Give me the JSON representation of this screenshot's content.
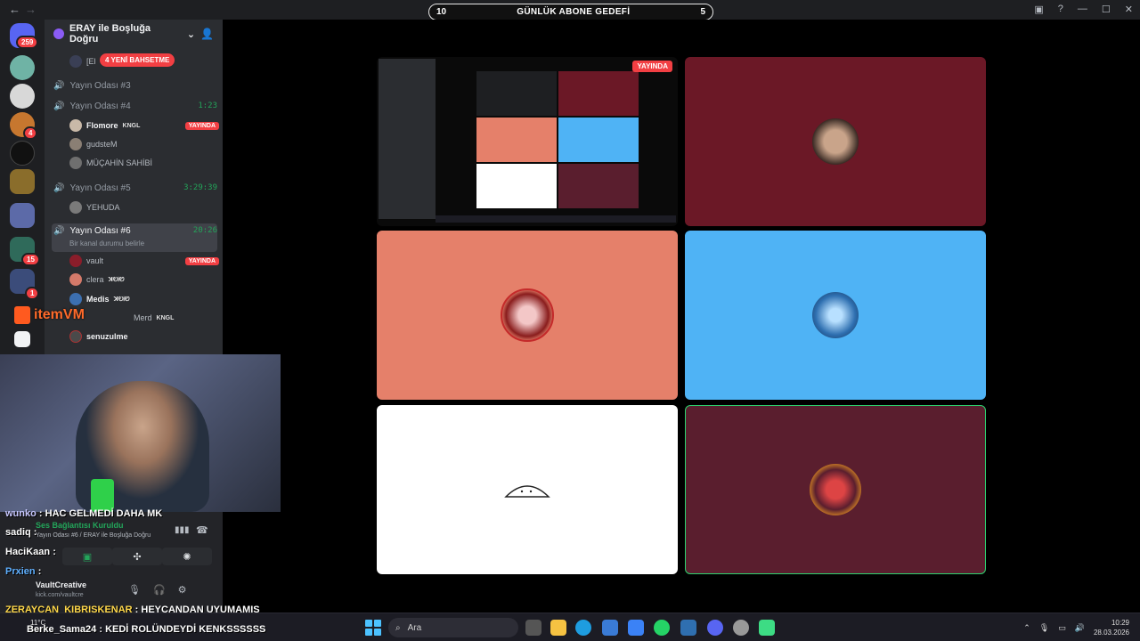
{
  "nav": {
    "back": "←",
    "forward": "→"
  },
  "goal": {
    "left": "10",
    "title": "GÜNLÜK ABONE GEDEFİ",
    "right": "5"
  },
  "window": {
    "inbox": "▣",
    "help": "?",
    "minimize": "—",
    "maximize": "☐",
    "close": "✕"
  },
  "rail": {
    "dm_badge": "259",
    "badge_2": "4",
    "badge_3": "15",
    "badge_4": "1"
  },
  "server": {
    "name": "ERAY ile Boşluğa Doğru",
    "chevron": "⌄",
    "mention_pill": "4 YENİ BAHSETME",
    "hidden_row": "[El"
  },
  "channels": [
    {
      "name": "Yayın Odası #3",
      "timer": ""
    },
    {
      "name": "Yayın Odası #4",
      "timer": "1:23"
    },
    {
      "name": "Yayın Odası #5",
      "timer": "3:29:39"
    },
    {
      "name": "Yayın Odası #6",
      "timer": "20:26",
      "status": "Bir kanal durumu belirle"
    }
  ],
  "room4_users": [
    {
      "name": "Flomore",
      "tag": "KNGL",
      "badge": "YAYINDA",
      "color": "#c9b9a8"
    },
    {
      "name": "gudsteM",
      "tag": "",
      "badge": "",
      "color": "#8a7f74"
    },
    {
      "name": "MÜÇAHİN SAHİBİ",
      "tag": "",
      "badge": "",
      "color": "#6f6f6f"
    }
  ],
  "room5_users": [
    {
      "name": "YEHUDA",
      "tag": "",
      "badge": "",
      "color": "#7a7a7a"
    }
  ],
  "room6_users": [
    {
      "name": "vault",
      "tag": "",
      "badge": "YAYINDA",
      "color": "#8a1d2a"
    },
    {
      "name": "clera",
      "tag": "ꓘᎧᎥᏬ",
      "badge": "",
      "color": "#d47a6a"
    },
    {
      "name": "Medis",
      "tag": "ꓘᎧᎥᏬ",
      "badge": "",
      "color": "#3c6fb0"
    },
    {
      "name": "Merd",
      "tag": "KNGL",
      "badge": "",
      "color": "#5a5a5a"
    },
    {
      "name": "senuzulme",
      "tag": "",
      "badge": "",
      "color": "#4a4a4a"
    }
  ],
  "overlay_logo": "itemVM",
  "stage": {
    "live_label": "YAYINDA",
    "tiles": [
      {
        "name": "screen-share",
        "bg": "#0a0a0a"
      },
      {
        "name": "maroon-user",
        "bg": "#6b1826"
      },
      {
        "name": "salmon-user",
        "bg": "#e5806a"
      },
      {
        "name": "blue-user",
        "bg": "#4fb3f5"
      },
      {
        "name": "white-user",
        "bg": "#ffffff"
      },
      {
        "name": "plum-user",
        "bg": "#5a1e2e"
      }
    ]
  },
  "chat": [
    {
      "user": "wunko",
      "msg": "HAC GELMEDİ DAHA MK"
    },
    {
      "user": "sadiq",
      "msg": ""
    },
    {
      "user": "HaciKaan",
      "msg": ""
    },
    {
      "user": "Prxien",
      "msg": ""
    }
  ],
  "connection": {
    "title": "Ses Bağlantısı Kuruldu",
    "subtitle": "Yayın Odası #6 / ERAY ile Boşluğa Doğru"
  },
  "panel_user": {
    "name": "VaultCreative",
    "sub": "kick.com/vaultcre"
  },
  "bottom_chat": [
    {
      "user": "ZERAYCAN_KIBRISKENAR",
      "msg": "HEYCANDAN UYUMAMIŞ"
    },
    {
      "user": "Berke_Sama24",
      "msg": "KEDİ ROLÜNDEYDİ KENKSSSSSS"
    }
  ],
  "taskbar": {
    "weather": "11°C",
    "search_placeholder": "Ara",
    "time": "10:29",
    "date": "28.03.2026"
  }
}
